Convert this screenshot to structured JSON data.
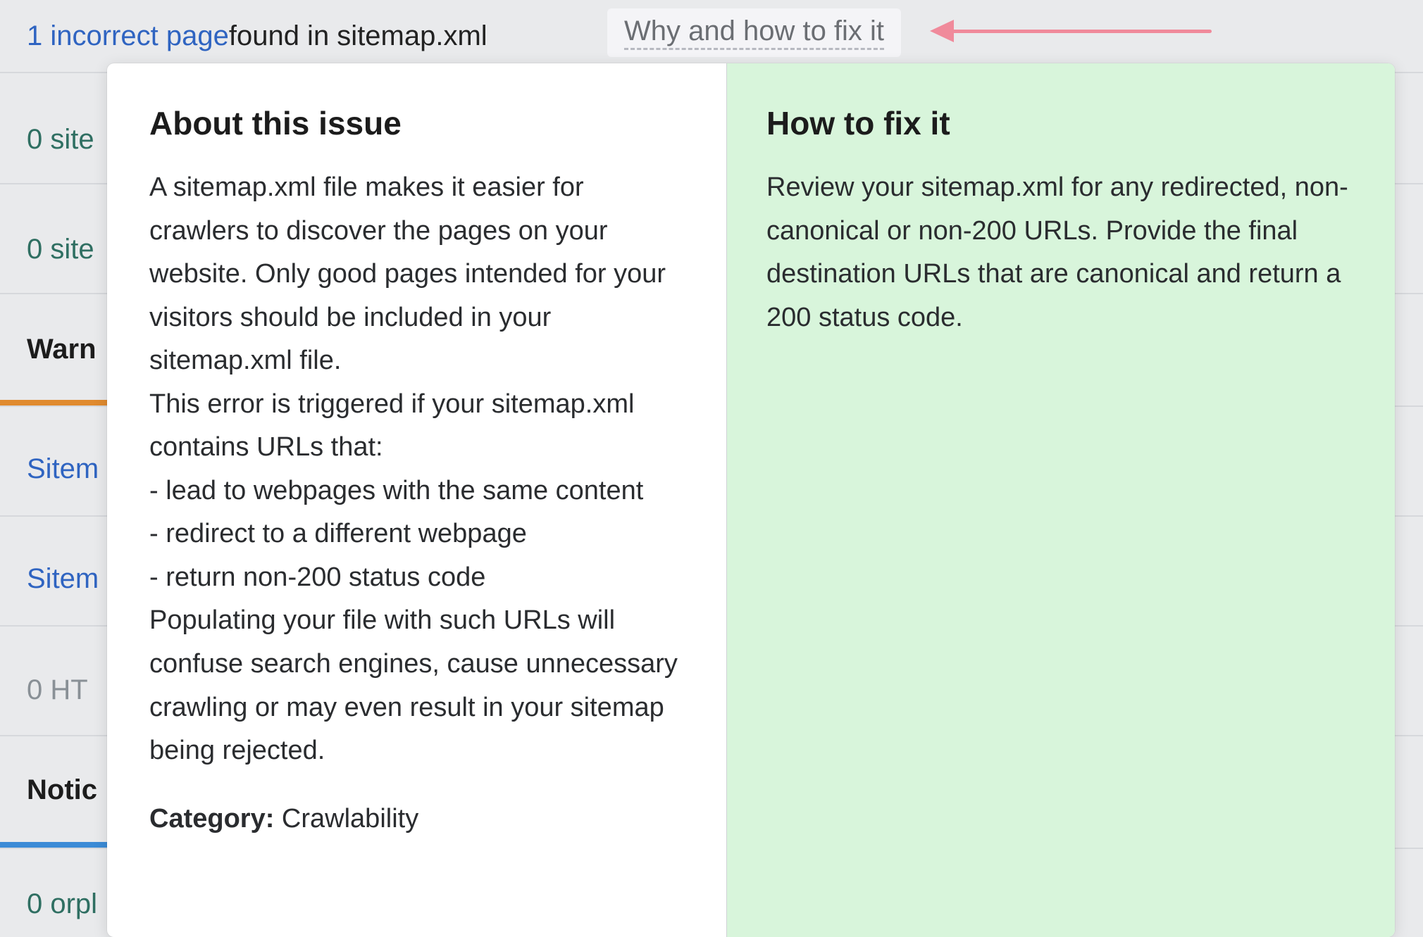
{
  "header": {
    "count_text": "1 incorrect page",
    "tail_text": " found in sitemap.xml",
    "fix_link": "Why and how to fix it"
  },
  "sidebar": {
    "items": [
      {
        "label": "0 site"
      },
      {
        "label": "0 site"
      },
      {
        "label": "Warn",
        "style": "dark"
      },
      {
        "label": "Sitem",
        "style": "blue"
      },
      {
        "label": "Sitem",
        "style": "blue"
      },
      {
        "label": "0 HT",
        "style": "gray"
      },
      {
        "label": "Notic",
        "style": "dark"
      },
      {
        "label": "0 orpl"
      }
    ]
  },
  "popup": {
    "about_heading": "About this issue",
    "about_body": "A sitemap.xml file makes it easier for crawlers to discover the pages on your website. Only good pages intended for your visitors should be included in your sitemap.xml file.\nThis error is triggered if your sitemap.xml contains URLs that:\n- lead to webpages with the same content\n- redirect to a different webpage\n- return non-200 status code\nPopulating your file with such URLs will confuse search engines, cause unnecessary crawling or may even result in your sitemap being rejected.",
    "category_label": "Category:",
    "category_value": " Crawlability",
    "fix_heading": "How to fix it",
    "fix_body": "Review your sitemap.xml for any redirected, non-canonical or non-200 URLs. Provide the final destination URLs that are canonical and return a 200 status code."
  }
}
